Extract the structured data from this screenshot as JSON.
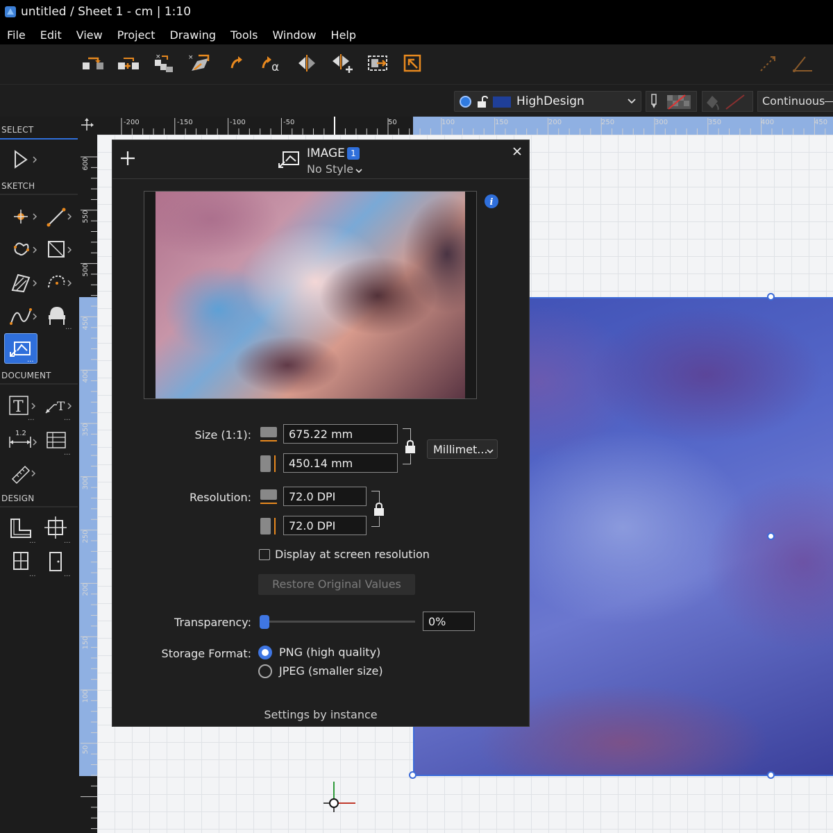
{
  "window": {
    "title": "untitled / Sheet 1 - cm | 1:10"
  },
  "menu": [
    "File",
    "Edit",
    "View",
    "Project",
    "Drawing",
    "Tools",
    "Window",
    "Help"
  ],
  "toolbar": {
    "icons": [
      "move-icon",
      "move-copy-icon",
      "multi-copy-icon",
      "distort-icon",
      "rotate-icon",
      "rotate-angle-icon",
      "mirror-icon",
      "mirror-copy-icon",
      "resize-frame-icon",
      "scale-icon"
    ],
    "right_icons": [
      "line-angle-icon",
      "angle-measure-icon"
    ]
  },
  "layerbar": {
    "layer_name": "HighDesign",
    "line_style": "Continuous",
    "layer_color": "#1f3f99"
  },
  "tools": {
    "sections": [
      "SELECT",
      "SKETCH",
      "DOCUMENT",
      "DESIGN"
    ],
    "dimension_tool_label": "1.2"
  },
  "rulers": {
    "horizontal": [
      "-200",
      "-150",
      "-100",
      "-50",
      "50",
      "100",
      "150",
      "200",
      "250",
      "300",
      "350",
      "400",
      "450"
    ],
    "vertical": [
      "600",
      "550",
      "500",
      "450",
      "400",
      "350",
      "300",
      "250",
      "200",
      "150",
      "100",
      "50"
    ]
  },
  "dialog": {
    "title": "IMAGE",
    "count": "1",
    "style": "No Style",
    "size_label": "Size (1:1):",
    "width_value": "675.22 mm",
    "height_value": "450.14 mm",
    "unit": "Millimet...",
    "resolution_label": "Resolution:",
    "res_h": "72.0 DPI",
    "res_v": "72.0 DPI",
    "screen_res_label": "Display at screen resolution",
    "screen_res_checked": false,
    "restore_label": "Restore Original Values",
    "transparency_label": "Transparency:",
    "transparency_value": "0%",
    "transparency_level": 0,
    "storage_label": "Storage Format:",
    "png_label": "PNG (high quality)",
    "jpeg_label": "JPEG (smaller size)",
    "storage_selected": "PNG",
    "footer": "Settings by instance"
  },
  "colors": {
    "accent": "#2f6fdb",
    "selection": "#3b6bd8",
    "tool_orange": "#e8891f"
  }
}
